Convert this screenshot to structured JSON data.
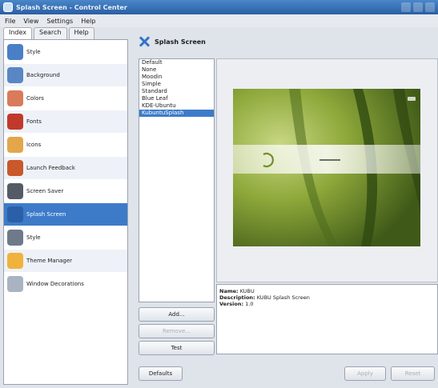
{
  "window": {
    "title": "Splash Screen - Control Center"
  },
  "menu": [
    "File",
    "View",
    "Settings",
    "Help"
  ],
  "tabs": [
    "Index",
    "Search",
    "Help"
  ],
  "sidebar": {
    "items": [
      {
        "label": "Style",
        "icon": "style-icon",
        "color": "#4a7fc8"
      },
      {
        "label": "Background",
        "icon": "background-icon",
        "color": "#5a86c4"
      },
      {
        "label": "Colors",
        "icon": "colors-icon",
        "color": "#d97a5b"
      },
      {
        "label": "Fonts",
        "icon": "fonts-icon",
        "color": "#c0392b"
      },
      {
        "label": "Icons",
        "icon": "icons-icon",
        "color": "#e3a64b"
      },
      {
        "label": "Launch Feedback",
        "icon": "launch-feedback-icon",
        "color": "#c9582b"
      },
      {
        "label": "Screen Saver",
        "icon": "screen-saver-icon",
        "color": "#555b66"
      },
      {
        "label": "Splash Screen",
        "icon": "splash-screen-icon",
        "color": "#2b5fa8",
        "selected": true
      },
      {
        "label": "Style",
        "icon": "style-icon-2",
        "color": "#6e7a8a"
      },
      {
        "label": "Theme Manager",
        "icon": "theme-manager-icon",
        "color": "#f0b23c"
      },
      {
        "label": "Window Decorations",
        "icon": "window-decorations-icon",
        "color": "#a9b3c2"
      }
    ]
  },
  "header": {
    "title": "Splash Screen"
  },
  "themes": [
    "Default",
    "None",
    "Moodin",
    "Simple",
    "Standard",
    "Blue Leaf",
    "KDE-Ubuntu",
    "KubuntuSplash"
  ],
  "themes_selected_index": 7,
  "info": {
    "name_label": "Name:",
    "name_value": "KUBU",
    "description_label": "Description:",
    "description_value": "KUBU Splash Screen",
    "version_label": "Version:",
    "version_value": "1.0"
  },
  "buttons": {
    "add": "Add...",
    "remove": "Remove...",
    "test": "Test",
    "defaults": "Defaults",
    "apply": "Apply",
    "reset": "Reset"
  }
}
